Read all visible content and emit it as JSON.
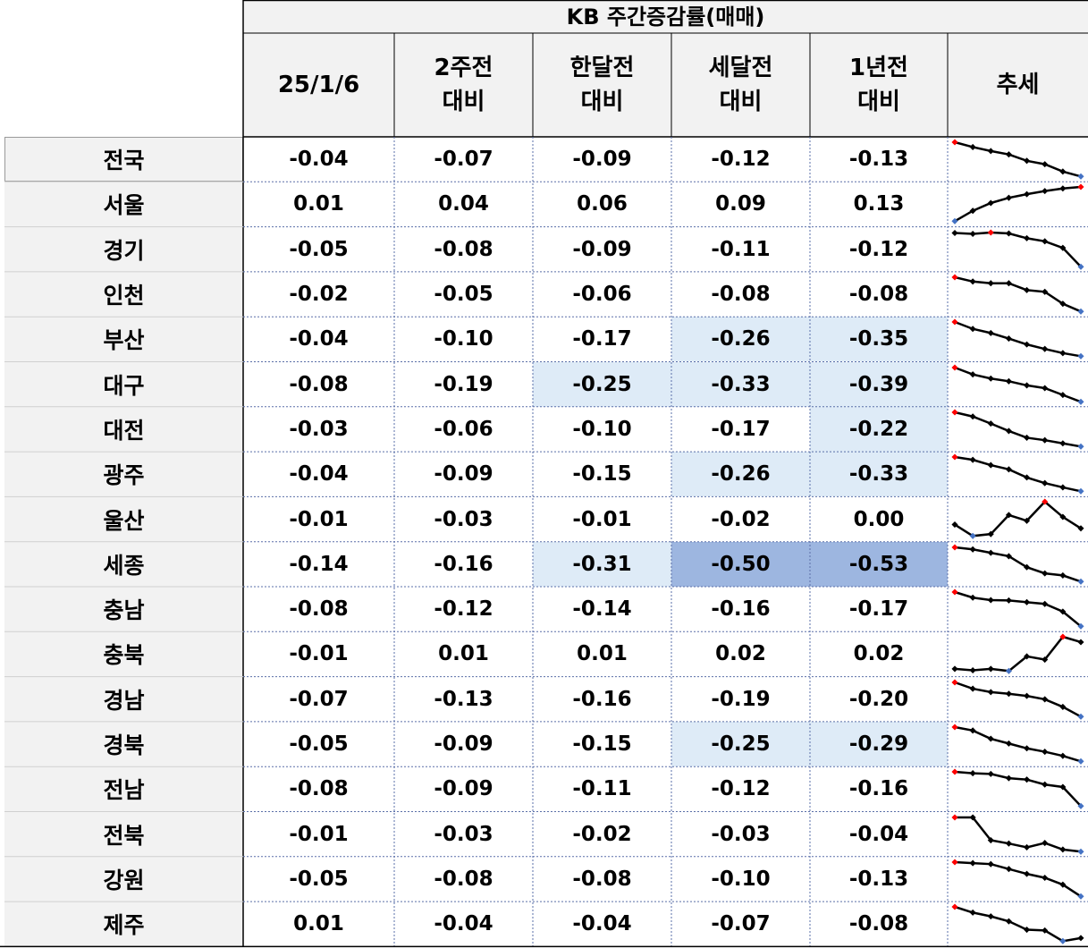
{
  "table": {
    "title": "KB 주간증감률(매매)",
    "columns": [
      "25/1/6",
      "2주전\n대비",
      "한달전\n대비",
      "세달전\n대비",
      "1년전\n대비",
      "추세"
    ],
    "rows": [
      {
        "region": "전국",
        "values": [
          "-0.04",
          "-0.07",
          "-0.09",
          "-0.12",
          "-0.13"
        ],
        "highlight": [
          "",
          "",
          "",
          "",
          ""
        ],
        "trend": [
          7,
          6,
          5.2,
          4.5,
          3.2,
          2.5,
          1,
          0
        ]
      },
      {
        "region": "서울",
        "values": [
          "0.01",
          "0.04",
          "0.06",
          "0.09",
          "0.13"
        ],
        "highlight": [
          "",
          "",
          "",
          "",
          ""
        ],
        "trend": [
          0,
          2,
          3.5,
          4.5,
          5.2,
          5.8,
          6.3,
          6.6
        ]
      },
      {
        "region": "경기",
        "values": [
          "-0.05",
          "-0.08",
          "-0.09",
          "-0.11",
          "-0.12"
        ],
        "highlight": [
          "",
          "",
          "",
          "",
          ""
        ],
        "trend": [
          7.7,
          7.5,
          7.8,
          7.6,
          6.5,
          5.8,
          4.3,
          0
        ]
      },
      {
        "region": "인천",
        "values": [
          "-0.02",
          "-0.05",
          "-0.06",
          "-0.08",
          "-0.08"
        ],
        "highlight": [
          "",
          "",
          "",
          "",
          ""
        ],
        "trend": [
          8,
          7,
          6.6,
          6.6,
          5,
          4.6,
          1.8,
          0
        ]
      },
      {
        "region": "부산",
        "values": [
          "-0.04",
          "-0.10",
          "-0.17",
          "-0.26",
          "-0.35"
        ],
        "highlight": [
          "",
          "",
          "",
          "light",
          "light"
        ],
        "trend": [
          10,
          8,
          6.8,
          5.2,
          3.5,
          2.2,
          1,
          0.1
        ]
      },
      {
        "region": "대구",
        "values": [
          "-0.08",
          "-0.19",
          "-0.25",
          "-0.33",
          "-0.39"
        ],
        "highlight": [
          "",
          "",
          "light",
          "light",
          "light"
        ],
        "trend": [
          10,
          8,
          6.8,
          6,
          4.8,
          4,
          2,
          0
        ]
      },
      {
        "region": "대전",
        "values": [
          "-0.03",
          "-0.06",
          "-0.10",
          "-0.17",
          "-0.22"
        ],
        "highlight": [
          "",
          "",
          "",
          "",
          "light"
        ],
        "trend": [
          10,
          8.8,
          6.8,
          4.7,
          2.8,
          2.1,
          1.2,
          0.3
        ]
      },
      {
        "region": "광주",
        "values": [
          "-0.04",
          "-0.09",
          "-0.15",
          "-0.26",
          "-0.33"
        ],
        "highlight": [
          "",
          "",
          "",
          "light",
          "light"
        ],
        "trend": [
          10,
          9.2,
          7.7,
          6.5,
          4.2,
          2.6,
          1.4,
          0.3
        ]
      },
      {
        "region": "울산",
        "values": [
          "-0.01",
          "-0.03",
          "-0.01",
          "-0.02",
          "0.00"
        ],
        "highlight": [
          "",
          "",
          "",
          "",
          "",
          ""
        ],
        "trend": [
          3,
          0,
          0.5,
          5.5,
          4,
          9,
          5,
          2
        ]
      },
      {
        "region": "세종",
        "values": [
          "-0.14",
          "-0.16",
          "-0.31",
          "-0.50",
          "-0.53"
        ],
        "highlight": [
          "",
          "",
          "light",
          "dark",
          "dark"
        ],
        "trend": [
          10,
          9.4,
          8.4,
          7.4,
          4.2,
          2.4,
          1.8,
          0
        ]
      },
      {
        "region": "충남",
        "values": [
          "-0.08",
          "-0.12",
          "-0.14",
          "-0.16",
          "-0.17"
        ],
        "highlight": [
          "",
          "",
          "",
          "",
          "",
          ""
        ],
        "trend": [
          10,
          8.4,
          7.7,
          7.6,
          7.1,
          6.6,
          4.4,
          0.2
        ]
      },
      {
        "region": "충북",
        "values": [
          "-0.01",
          "0.01",
          "0.01",
          "0.02",
          "0.02"
        ],
        "highlight": [
          "",
          "",
          "",
          "",
          ""
        ],
        "trend": [
          1,
          0.6,
          1,
          0.4,
          4.5,
          3.6,
          10,
          8.5
        ]
      },
      {
        "region": "경남",
        "values": [
          "-0.07",
          "-0.13",
          "-0.16",
          "-0.19",
          "-0.20"
        ],
        "highlight": [
          "",
          "",
          "",
          "",
          ""
        ],
        "trend": [
          10,
          8.5,
          7.7,
          7.3,
          6.8,
          6,
          4.2,
          1.9
        ]
      },
      {
        "region": "경북",
        "values": [
          "-0.05",
          "-0.09",
          "-0.15",
          "-0.25",
          "-0.29"
        ],
        "highlight": [
          "",
          "",
          "",
          "light",
          "light"
        ],
        "trend": [
          10,
          9,
          6.6,
          5.2,
          3.8,
          2.8,
          1.6,
          0
        ]
      },
      {
        "region": "전남",
        "values": [
          "-0.08",
          "-0.09",
          "-0.11",
          "-0.12",
          "-0.16"
        ],
        "highlight": [
          "",
          "",
          "",
          "",
          ""
        ],
        "trend": [
          9.7,
          9.3,
          9.1,
          7.9,
          7.5,
          6.1,
          5.4,
          0
        ]
      },
      {
        "region": "전북",
        "values": [
          "-0.01",
          "-0.03",
          "-0.02",
          "-0.03",
          "-0.04"
        ],
        "highlight": [
          "",
          "",
          "",
          "",
          ""
        ],
        "trend": [
          6.3,
          6.3,
          2.1,
          1.5,
          0.8,
          1.6,
          0.4,
          0
        ]
      },
      {
        "region": "강원",
        "values": [
          "-0.05",
          "-0.08",
          "-0.08",
          "-0.10",
          "-0.13"
        ],
        "highlight": [
          "",
          "",
          "",
          "",
          ""
        ],
        "trend": [
          7.2,
          7,
          6.8,
          5.8,
          4.8,
          4,
          2.6,
          0.2
        ]
      },
      {
        "region": "제주",
        "values": [
          "0.01",
          "-0.04",
          "-0.04",
          "-0.07",
          "-0.08"
        ],
        "highlight": [
          "",
          "",
          "",
          "",
          ""
        ],
        "trend": [
          9,
          7.5,
          6.5,
          5.2,
          3,
          2.8,
          0,
          0.8
        ]
      }
    ]
  },
  "colors": {
    "highlight_light": "#deebf7",
    "highlight_dark": "#9db6e0",
    "spark_line": "#000000",
    "spark_high": "#ff0000",
    "spark_low": "#4472c4"
  }
}
